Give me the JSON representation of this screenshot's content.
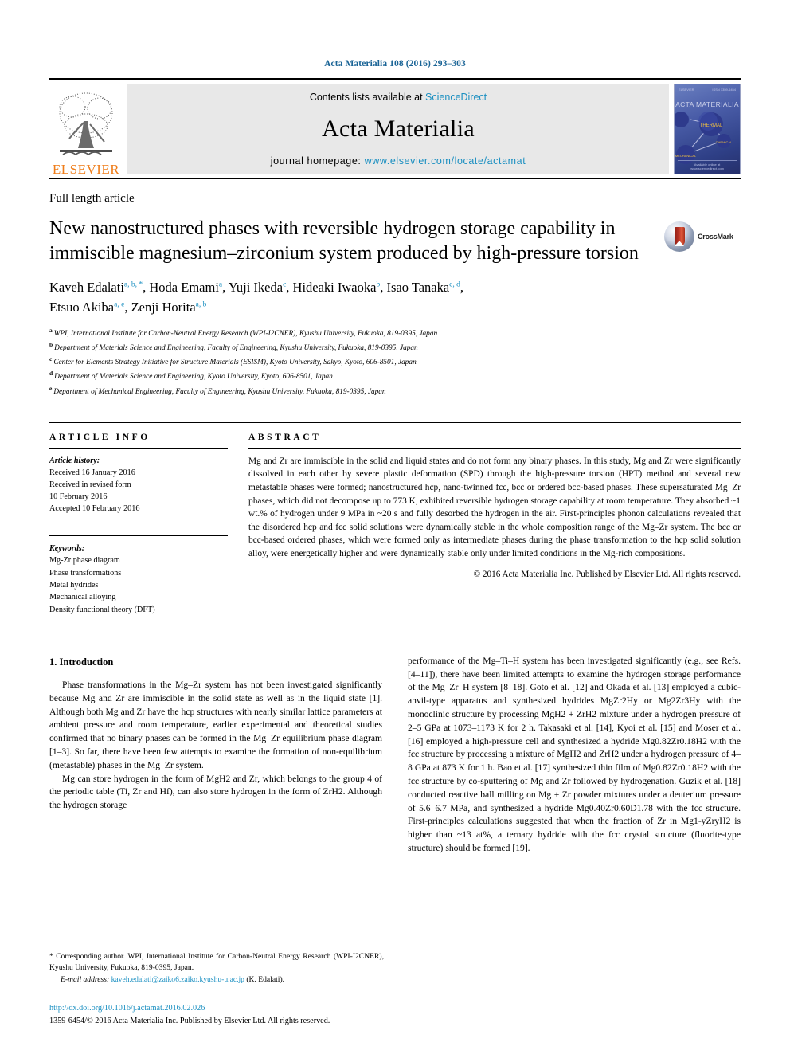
{
  "running_head": "Acta Materialia 108 (2016) 293–303",
  "masthead": {
    "publisher_name": "ELSEVIER",
    "contents_prefix": "Contents lists available at ",
    "contents_link": "ScienceDirect",
    "journal_title": "Acta Materialia",
    "homepage_prefix": "journal homepage: ",
    "homepage_url": "www.elsevier.com/locate/actamat",
    "cover": {
      "title": "ACTA MATERIALIA",
      "top_left": "ELSEVIER",
      "top_right": "ISSN 1359-6454",
      "bottom": "Available online at www.sciencedirect.com",
      "node_labels": [
        "ELECTRONIC",
        "THERMAL",
        "CHEMICAL",
        "MECHANICAL"
      ]
    }
  },
  "article_type": "Full length article",
  "title": "New nanostructured phases with reversible hydrogen storage capability in immiscible magnesium–zirconium system produced by high-pressure torsion",
  "crossmark_label": "CrossMark",
  "authors_line_1_parts": [
    {
      "name": "Kaveh Edalati",
      "marks": "a, b, *"
    },
    {
      "name": "Hoda Emami",
      "marks": "a"
    },
    {
      "name": "Yuji Ikeda",
      "marks": "c"
    },
    {
      "name": "Hideaki Iwaoka",
      "marks": "b"
    },
    {
      "name": "Isao Tanaka",
      "marks": "c, d"
    }
  ],
  "authors_line_2_parts": [
    {
      "name": "Etsuo Akiba",
      "marks": "a, e"
    },
    {
      "name": "Zenji Horita",
      "marks": "a, b"
    }
  ],
  "affiliations": [
    {
      "mark": "a",
      "text": "WPI, International Institute for Carbon-Neutral Energy Research (WPI-I2CNER), Kyushu University, Fukuoka, 819-0395, Japan"
    },
    {
      "mark": "b",
      "text": "Department of Materials Science and Engineering, Faculty of Engineering, Kyushu University, Fukuoka, 819-0395, Japan"
    },
    {
      "mark": "c",
      "text": "Center for Elements Strategy Initiative for Structure Materials (ESISM), Kyoto University, Sakyo, Kyoto, 606-8501, Japan"
    },
    {
      "mark": "d",
      "text": "Department of Materials Science and Engineering, Kyoto University, Kyoto, 606-8501, Japan"
    },
    {
      "mark": "e",
      "text": "Department of Mechanical Engineering, Faculty of Engineering, Kyushu University, Fukuoka, 819-0395, Japan"
    }
  ],
  "article_info": {
    "heading": "ARTICLE INFO",
    "history_label": "Article history:",
    "history_lines": [
      "Received 16 January 2016",
      "Received in revised form",
      "10 February 2016",
      "Accepted 10 February 2016"
    ],
    "keywords_label": "Keywords:",
    "keywords": [
      "Mg-Zr phase diagram",
      "Phase transformations",
      "Metal hydrides",
      "Mechanical alloying",
      "Density functional theory (DFT)"
    ]
  },
  "abstract": {
    "heading": "ABSTRACT",
    "text": "Mg and Zr are immiscible in the solid and liquid states and do not form any binary phases. In this study, Mg and Zr were significantly dissolved in each other by severe plastic deformation (SPD) through the high-pressure torsion (HPT) method and several new metastable phases were formed; nanostructured hcp, nano-twinned fcc, bcc or ordered bcc-based phases. These supersaturated Mg–Zr phases, which did not decompose up to 773 K, exhibited reversible hydrogen storage capability at room temperature. They absorbed ~1 wt.% of hydrogen under 9 MPa in ~20 s and fully desorbed the hydrogen in the air. First-principles phonon calculations revealed that the disordered hcp and fcc solid solutions were dynamically stable in the whole composition range of the Mg–Zr system. The bcc or bcc-based ordered phases, which were formed only as intermediate phases during the phase transformation to the hcp solid solution alloy, were energetically higher and were dynamically stable only under limited conditions in the Mg-rich compositions.",
    "copyright": "© 2016 Acta Materialia Inc. Published by Elsevier Ltd. All rights reserved."
  },
  "body": {
    "section_number_title": "1.  Introduction",
    "left_paragraph_1": "Phase transformations in the Mg–Zr system has not been investigated significantly because Mg and Zr are immiscible in the solid state as well as in the liquid state [1]. Although both Mg and Zr have the hcp structures with nearly similar lattice parameters at ambient pressure and room temperature, earlier experimental and theoretical studies confirmed that no binary phases can be formed in the Mg–Zr equilibrium phase diagram [1–3]. So far, there have been few attempts to examine the formation of non-equilibrium (metastable) phases in the Mg–Zr system.",
    "left_paragraph_2": "Mg can store hydrogen in the form of MgH2 and Zr, which belongs to the group 4 of the periodic table (Ti, Zr and Hf), can also store hydrogen in the form of ZrH2. Although the hydrogen storage",
    "right_paragraph_1": "performance of the Mg–Ti–H system has been investigated significantly (e.g., see Refs. [4–11]), there have been limited attempts to examine the hydrogen storage performance of the Mg–Zr–H system [8–18]. Goto et al. [12] and Okada et al. [13] employed a cubic-anvil-type apparatus and synthesized hydrides MgZr2Hy or Mg2Zr3Hy with the monoclinic structure by processing MgH2 + ZrH2 mixture under a hydrogen pressure of 2–5 GPa at 1073–1173 K for 2 h. Takasaki et al. [14], Kyoi et al. [15] and Moser et al. [16] employed a high-pressure cell and synthesized a hydride Mg0.82Zr0.18H2 with the fcc structure by processing a mixture of MgH2 and ZrH2 under a hydrogen pressure of 4–8 GPa at 873 K for 1 h. Bao et al. [17] synthesized thin film of Mg0.82Zr0.18H2 with the fcc structure by co-sputtering of Mg and Zr followed by hydrogenation. Guzik et al. [18] conducted reactive ball milling on Mg + Zr powder mixtures under a deuterium pressure of 5.6–6.7 MPa, and synthesized a hydride Mg0.40Zr0.60D1.78 with the fcc structure. First-principles calculations suggested that when the fraction of Zr in Mg1-yZryH2 is higher than ~13 at%, a ternary hydride with the fcc crystal structure (fluorite-type structure) should be formed [19]."
  },
  "footnotes": {
    "corresponding": "* Corresponding author. WPI, International Institute for Carbon-Neutral Energy Research (WPI-I2CNER), Kyushu University, Fukuoka, 819-0395, Japan.",
    "email_label": "E-mail address:",
    "email": "kaveh.edalati@zaiko6.zaiko.kyushu-u.ac.jp",
    "email_suffix": "(K. Edalati).",
    "doi": "http://dx.doi.org/10.1016/j.actamat.2016.02.026",
    "issn_line": "1359-6454/© 2016 Acta Materialia Inc. Published by Elsevier Ltd. All rights reserved."
  },
  "colors": {
    "link_blue": "#1a8fc1",
    "headline_blue": "#1a6496",
    "elsevier_orange": "#ef7d1a",
    "masthead_gray": "#e8e8e8"
  }
}
